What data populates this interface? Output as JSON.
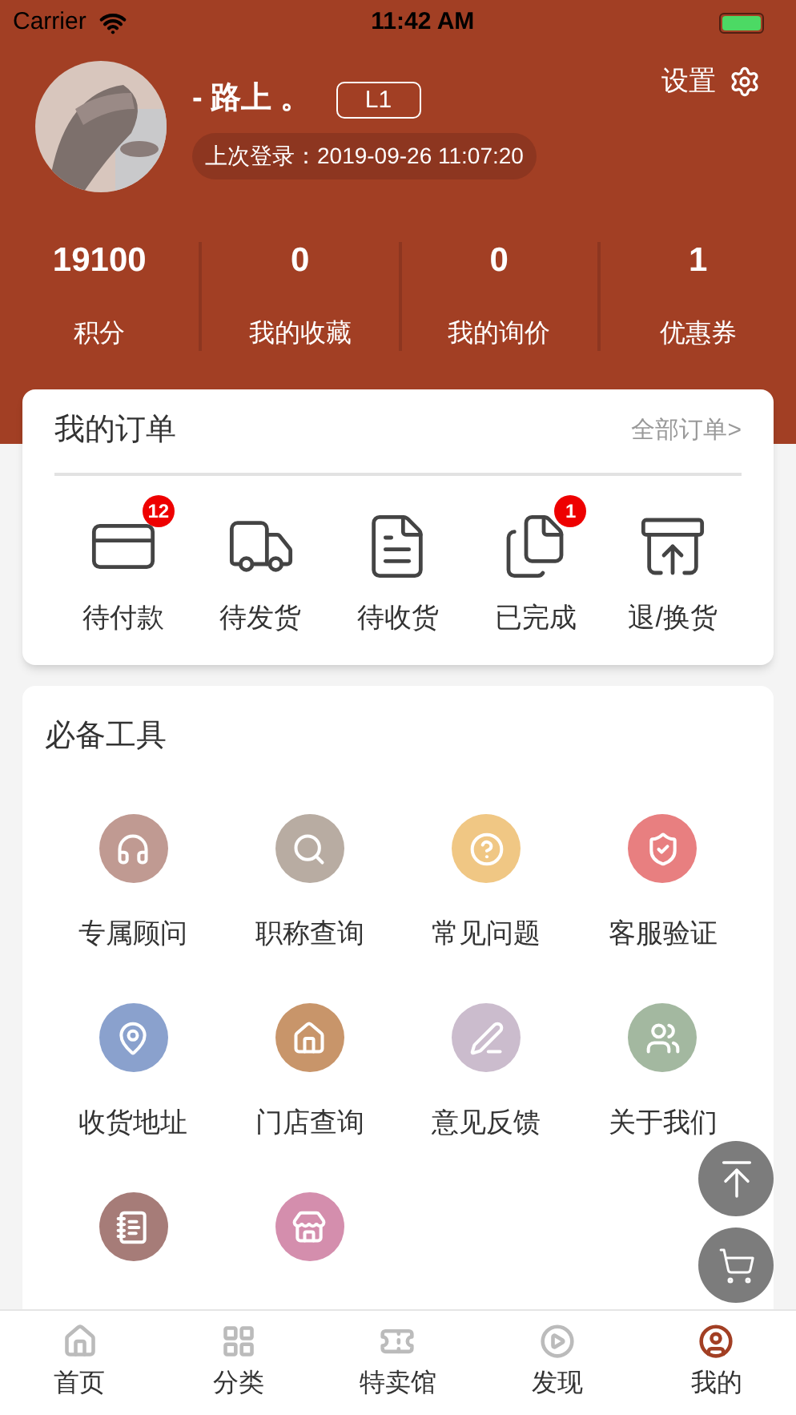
{
  "status_bar": {
    "carrier": "Carrier",
    "time": "11:42 AM"
  },
  "profile": {
    "name": "- 路上 。",
    "level": "L1",
    "last_login": "上次登录：2019-09-26 11:07:20",
    "settings_label": "设置"
  },
  "stats": [
    {
      "value": "19100",
      "label": "积分"
    },
    {
      "value": "0",
      "label": "我的收藏"
    },
    {
      "value": "0",
      "label": "我的询价"
    },
    {
      "value": "1",
      "label": "优惠券"
    }
  ],
  "orders": {
    "title": "我的订单",
    "all_link": "全部订单>",
    "items": [
      {
        "label": "待付款",
        "badge": "12"
      },
      {
        "label": "待发货"
      },
      {
        "label": "待收货"
      },
      {
        "label": "已完成",
        "badge": "1"
      },
      {
        "label": "退/换货"
      }
    ]
  },
  "tools": {
    "title": "必备工具",
    "items": [
      {
        "label": "专属顾问",
        "color": "#c09a92"
      },
      {
        "label": "职称查询",
        "color": "#b8aca2"
      },
      {
        "label": "常见问题",
        "color": "#f0c784"
      },
      {
        "label": "客服验证",
        "color": "#e87f80"
      },
      {
        "label": "收货地址",
        "color": "#8aa1cd"
      },
      {
        "label": "门店查询",
        "color": "#c8956a"
      },
      {
        "label": "意见反馈",
        "color": "#cbbccd"
      },
      {
        "label": "关于我们",
        "color": "#a3b8a0"
      },
      {
        "color": "#a67c78"
      },
      {
        "color": "#d48ead"
      }
    ]
  },
  "tab_bar": [
    {
      "label": "首页",
      "selected": false
    },
    {
      "label": "分类",
      "selected": false
    },
    {
      "label": "特卖馆",
      "selected": false
    },
    {
      "label": "发现",
      "selected": false
    },
    {
      "label": "我的",
      "selected": true
    }
  ]
}
